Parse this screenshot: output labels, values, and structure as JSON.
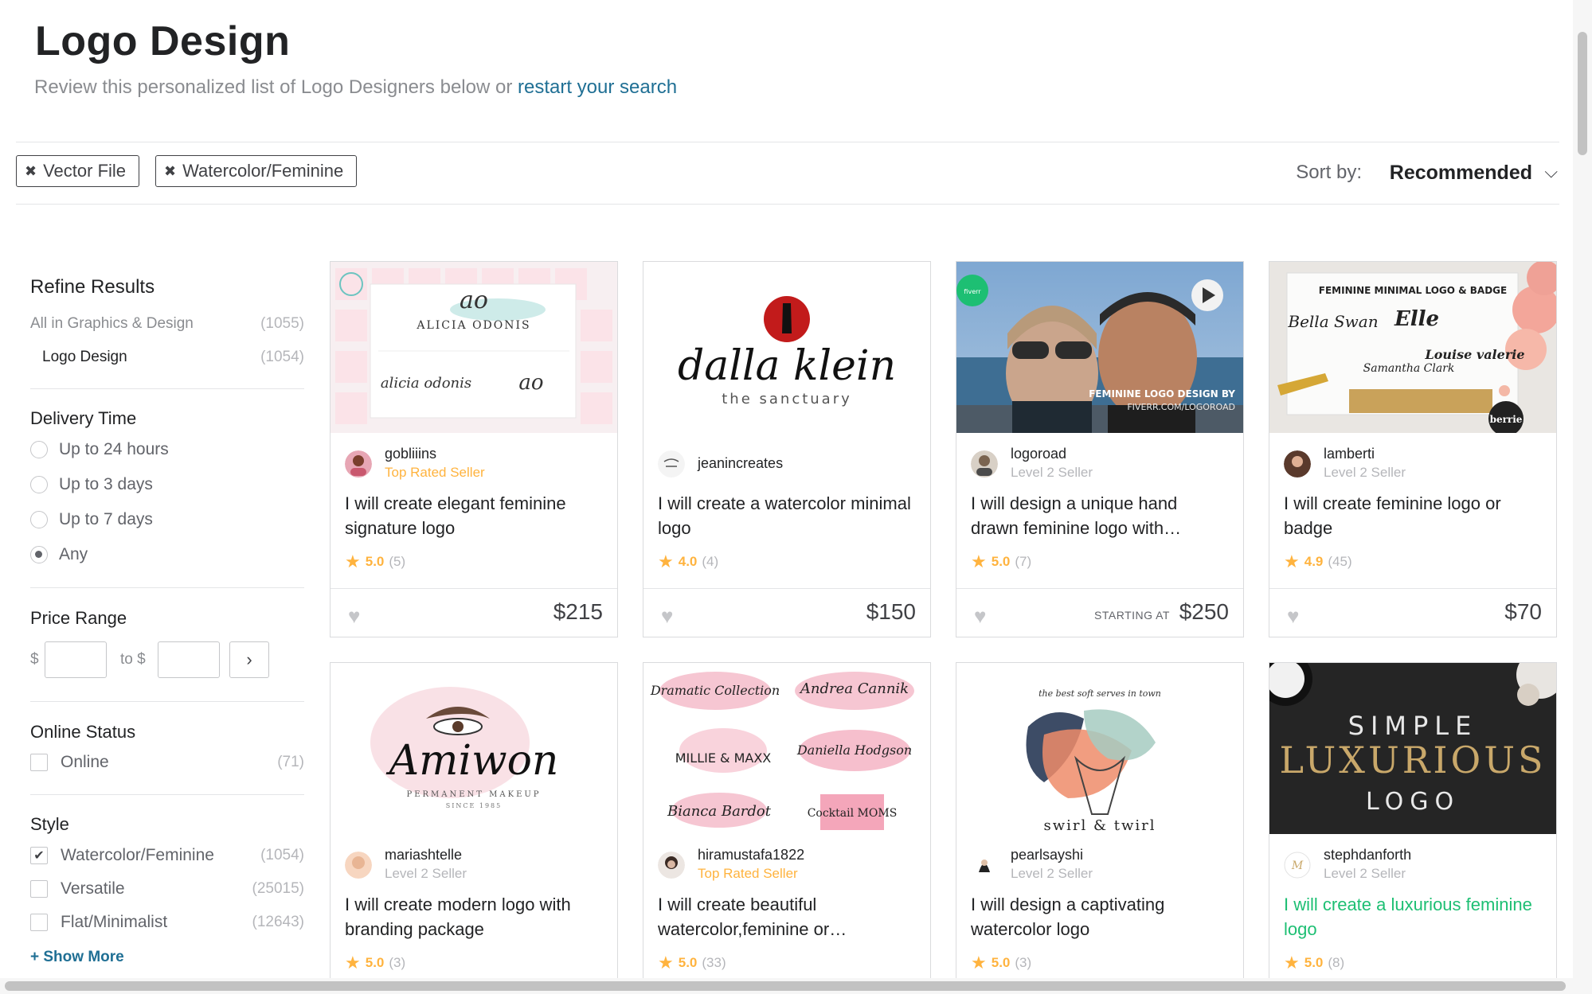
{
  "header": {
    "title": "Logo Design",
    "subtitle_prefix": "Review this personalized list of Logo Designers below or",
    "subtitle_link": "restart your search"
  },
  "filters": {
    "chips": [
      "Vector File",
      "Watercolor/Feminine"
    ],
    "sort_label": "Sort by:",
    "sort_value": "Recommended"
  },
  "sidebar": {
    "title": "Refine Results",
    "category": {
      "label": "All in Graphics & Design",
      "count": "(1055)"
    },
    "subcategory": {
      "label": "Logo Design",
      "count": "(1054)"
    },
    "delivery": {
      "title": "Delivery Time",
      "options": [
        "Up to 24 hours",
        "Up to 3 days",
        "Up to 7 days",
        "Any"
      ],
      "selected": "Any"
    },
    "price": {
      "title": "Price Range",
      "currency": "$",
      "to": "to $"
    },
    "online": {
      "title": "Online Status",
      "label": "Online",
      "count": "(71)"
    },
    "style": {
      "title": "Style",
      "items": [
        {
          "label": "Watercolor/Feminine",
          "count": "(1054)",
          "checked": true
        },
        {
          "label": "Versatile",
          "count": "(25015)",
          "checked": false
        },
        {
          "label": "Flat/Minimalist",
          "count": "(12643)",
          "checked": false
        }
      ],
      "show_more": "+ Show More"
    }
  },
  "gigs": [
    {
      "seller": "gobliiins",
      "level": "Top Rated Seller",
      "title": "I will create elegant feminine signature logo",
      "rating": "5.0",
      "reviews": "(5)",
      "price": "$215",
      "starting": ""
    },
    {
      "seller": "jeanincreates",
      "level": "",
      "title": "I will create a watercolor minimal logo",
      "rating": "4.0",
      "reviews": "(4)",
      "price": "$150",
      "starting": ""
    },
    {
      "seller": "logoroad",
      "level": "Level 2 Seller",
      "title": "I will design a unique hand drawn feminine logo with…",
      "rating": "5.0",
      "reviews": "(7)",
      "price": "$250",
      "starting": "STARTING AT"
    },
    {
      "seller": "lamberti",
      "level": "Level 2 Seller",
      "title": "I will create feminine logo or badge",
      "rating": "4.9",
      "reviews": "(45)",
      "price": "$70",
      "starting": ""
    },
    {
      "seller": "mariashtelle",
      "level": "Level 2 Seller",
      "title": "I will create modern logo with branding package",
      "rating": "5.0",
      "reviews": "(3)",
      "price": "",
      "starting": ""
    },
    {
      "seller": "hiramustafa1822",
      "level": "Top Rated Seller",
      "title": "I will create beautiful watercolor,feminine or…",
      "rating": "5.0",
      "reviews": "(33)",
      "price": "",
      "starting": ""
    },
    {
      "seller": "pearlsayshi",
      "level": "Level 2 Seller",
      "title": "I will design a captivating watercolor logo",
      "rating": "5.0",
      "reviews": "(3)",
      "price": "",
      "starting": ""
    },
    {
      "seller": "stephdanforth",
      "level": "Level 2 Seller",
      "title": "I will create a luxurious feminine logo",
      "rating": "5.0",
      "reviews": "(8)",
      "price": "",
      "starting": ""
    }
  ],
  "thumbs": {
    "t1_brand": "ALICIA ODONIS",
    "t1_script": "alicia odonis",
    "t1_monogram": "ao",
    "t2_brand": "dalla klein",
    "t2_sub": "the sanctuary",
    "t3_caption1": "FEMININE LOGO DESIGN BY",
    "t3_caption2": "FIVERR.COM/LOGOROAD",
    "t3_badge": "fiverr",
    "t4_title": "FEMININE MINIMAL LOGO & BADGE",
    "t4_name1": "Bella Swan",
    "t4_name2": "Elle",
    "t4_name3": "Louise valerie",
    "t4_name4": "Samantha Clark",
    "t4_badge": "berrie",
    "t5_brand": "Amiwon",
    "t5_sub": "PERMANENT MAKEUP",
    "t5_since": "SINCE 1985",
    "t6_a": "Dramatic Collection",
    "t6_b": "Andrea Cannik",
    "t6_c": "MILLIE & MAXX",
    "t6_d": "Daniella Hodgson",
    "t6_e": "Bianca Bardot",
    "t6_f": "Cocktail MOMS",
    "t7_arc": "the best soft serves in town",
    "t7_brand": "swirl & twirl",
    "t8_l1": "SIMPLE",
    "t8_l2": "LUXURIOUS",
    "t8_l3": "LOGO"
  },
  "colors": {
    "accent_link": "#1f6f94",
    "star": "#ffb33e",
    "green": "#1dbf73"
  }
}
